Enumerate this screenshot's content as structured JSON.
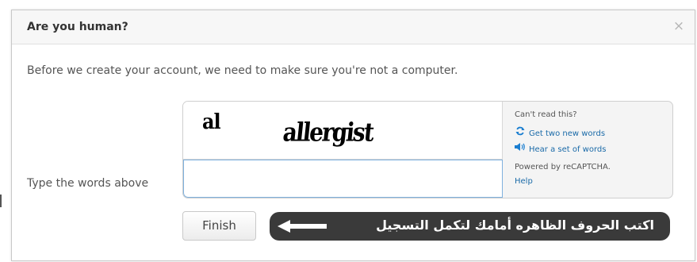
{
  "dialog": {
    "title": "Are you human?",
    "close_label": "×",
    "intro": "Before we create your account, we need to make sure you're not a computer.",
    "type_label": "Type the words above",
    "finish_label": "Finish"
  },
  "captcha": {
    "word1": "al",
    "word2": "allergist",
    "input_value": "",
    "cant_read": "Can't read this?",
    "get_new_words": "Get two new words",
    "hear_words": "Hear a set of words",
    "powered_by": "Powered by reCAPTCHA.",
    "help": "Help",
    "refresh_icon": "refresh-icon",
    "audio_icon": "speaker-icon"
  },
  "annotation": {
    "text": "اكتب الحروف الظاهره أمامك لتكمل التسجيل",
    "arrow_icon": "arrow-left-icon"
  },
  "colors": {
    "link": "#1a6aa8",
    "input_border": "#7fb1de",
    "annotation_bg": "#3a3a3a"
  }
}
